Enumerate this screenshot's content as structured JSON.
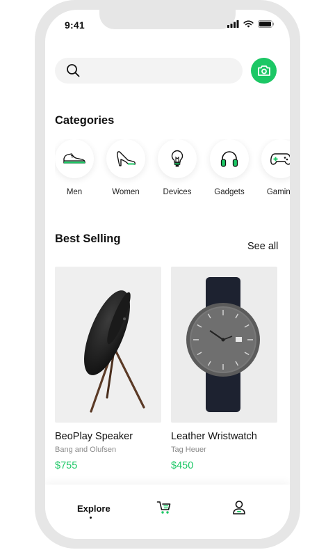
{
  "status_bar": {
    "time": "9:41"
  },
  "search": {
    "placeholder": "",
    "icon": "search-icon"
  },
  "camera_button": {
    "icon": "camera-icon"
  },
  "categories": {
    "title": "Categories",
    "items": [
      {
        "label": "Men",
        "icon": "sneaker-icon"
      },
      {
        "label": "Women",
        "icon": "high-heel-icon"
      },
      {
        "label": "Devices",
        "icon": "lightbulb-icon"
      },
      {
        "label": "Gadgets",
        "icon": "headphones-icon"
      },
      {
        "label": "Gaming",
        "icon": "gamepad-icon"
      }
    ]
  },
  "best_selling": {
    "title": "Best Selling",
    "see_all": "See all",
    "products": [
      {
        "name": "BeoPlay Speaker",
        "brand": "Bang and Olufsen",
        "price": "$755"
      },
      {
        "name": "Leather Wristwatch",
        "brand": "Tag Heuer",
        "price": "$450"
      }
    ]
  },
  "bottom_nav": {
    "explore_label": "Explore",
    "cart_icon": "cart-icon",
    "profile_icon": "user-icon"
  },
  "colors": {
    "accent": "#1cc765",
    "frame": "#e6e6e6"
  }
}
